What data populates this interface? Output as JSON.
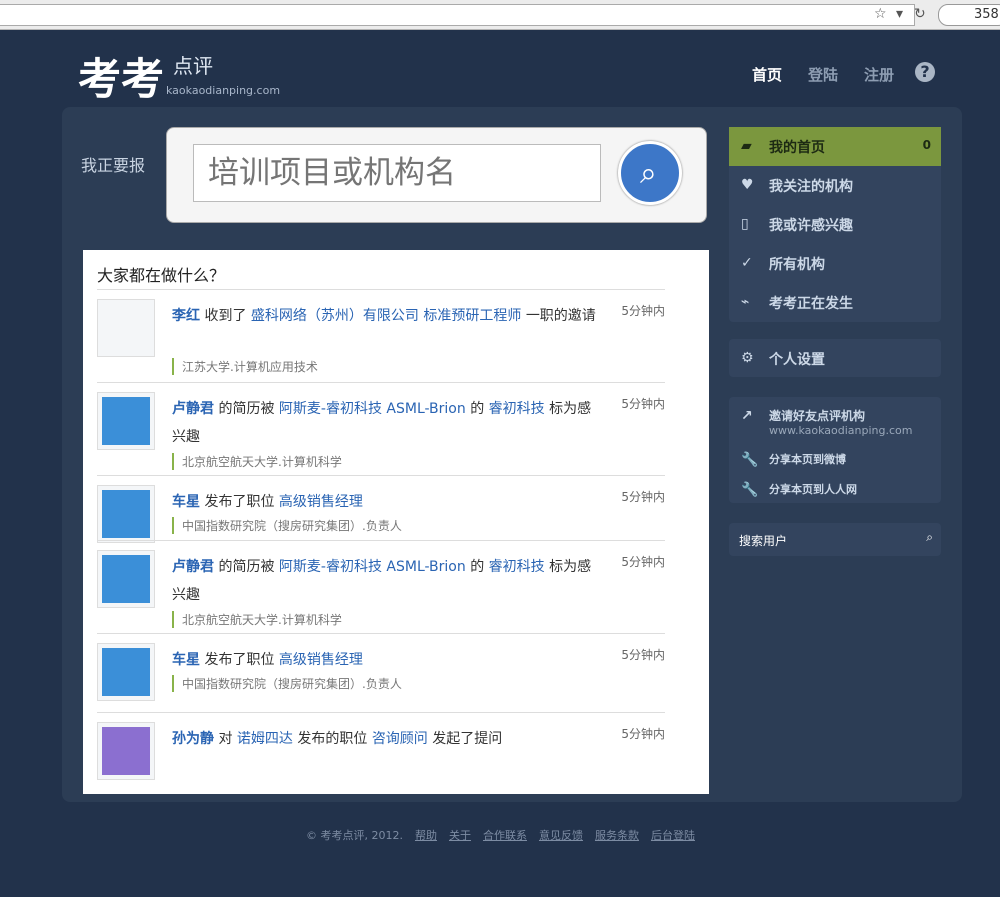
{
  "nav": {
    "home": "首页",
    "login": "登陆",
    "signup": "注册",
    "help": "?"
  },
  "logo": {
    "main": "考考",
    "sub": "点评",
    "domain": "kaokaodianping.com"
  },
  "search": {
    "label": "我正要报",
    "placeholder": "培训项目或机构名"
  },
  "feed": {
    "title": "大家都在做什么？",
    "items": [
      {
        "user": "李红",
        "verb": "收到了",
        "a": "盛科网络（苏州）有限公司",
        "b": "标准预研工程师",
        "c": "一职的邀请",
        "sub": "江苏大学.计算机应用技术",
        "time": "5分钟内"
      },
      {
        "user": "卢静君",
        "verb": "的简历被",
        "a": "阿斯麦-睿初科技 ASML-Brion",
        "b": "的",
        "c": "睿初科技",
        "d": "标为感兴趣",
        "sub": "北京航空航天大学.计算机科学",
        "time": "5分钟内"
      },
      {
        "user": "车星",
        "verb": "发布了职位",
        "a": "高级销售经理",
        "sub": "中国指数研究院（搜房研究集团）.负责人",
        "time": "5分钟内"
      },
      {
        "user": "卢静君",
        "verb": "的简历被",
        "a": "阿斯麦-睿初科技 ASML-Brion",
        "b": "的",
        "c": "睿初科技",
        "d": "标为感兴趣",
        "sub": "北京航空航天大学.计算机科学",
        "time": "5分钟内"
      },
      {
        "user": "车星",
        "verb": "发布了职位",
        "a": "高级销售经理",
        "sub": "中国指数研究院（搜房研究集团）.负责人",
        "time": "5分钟内"
      },
      {
        "user": "孙为静",
        "verb": "对",
        "a": "诺姆四达",
        "b": "发布的职位",
        "c": "咨询顾问",
        "d": "发起了提问",
        "sub": "",
        "time": "5分钟内"
      }
    ]
  },
  "side": {
    "home": "我的首页",
    "count": "0",
    "follow": "我关注的机构",
    "interest": "我或许感兴趣",
    "all": "所有机构",
    "now": "考考正在发生",
    "settings": "个人设置",
    "invite": "邀请好友点评机构",
    "invite_url": "www.kaokaodianping.com",
    "weibo": "分享本页到微博",
    "renren": "分享本页到人人网",
    "search_users": "搜索用户"
  },
  "footer": {
    "copy": "© 考考点评, 2012.",
    "help": "帮助",
    "about": "关于",
    "coop": "合作联系",
    "feedback": "意见反馈",
    "terms": "服务条款",
    "admin": "后台登陆"
  }
}
